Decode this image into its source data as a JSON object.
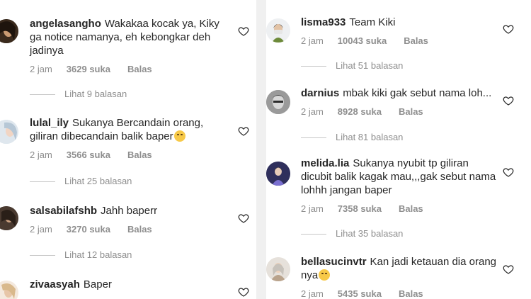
{
  "colors": {
    "text": "#262626",
    "meta": "#8e8e8e",
    "heart_stroke": "#262626",
    "background": "#ffffff"
  },
  "left_column": [
    {
      "username": "angelasangho",
      "text": "Wakakaa kocak ya, Kiky ga notice namanya, eh kebongkar deh jadinya",
      "time": "2 jam",
      "likes": "3629 suka",
      "reply": "Balas",
      "view_replies": "Lihat 9 balasan"
    },
    {
      "username": "lulal_ily",
      "text": "Sukanya Bercandain orang, giliran dibecandain balik baper",
      "emoji": "crying-face-icon",
      "time": "2 jam",
      "likes": "3566 suka",
      "reply": "Balas",
      "view_replies": "Lihat 25 balasan"
    },
    {
      "username": "salsabilafshb",
      "text": "Jahh baperr",
      "time": "2 jam",
      "likes": "3270 suka",
      "reply": "Balas",
      "view_replies": "Lihat 12 balasan"
    },
    {
      "username": "zivaasyah",
      "text": "Baper"
    }
  ],
  "right_column": [
    {
      "username": "lisma933",
      "text": "Team Kiki",
      "time": "2 jam",
      "likes": "10043 suka",
      "reply": "Balas",
      "view_replies": "Lihat 51 balasan"
    },
    {
      "username": "darnius",
      "text": "mbak kiki gak sebut nama loh...",
      "time": "2 jam",
      "likes": "8928 suka",
      "reply": "Balas",
      "view_replies": "Lihat 81 balasan"
    },
    {
      "username": "melida.lia",
      "text": "Sukanya nyubit tp giliran dicubit balik kagak mau,,,gak sebut nama lohhh jangan baper",
      "time": "2 jam",
      "likes": "7358 suka",
      "reply": "Balas",
      "view_replies": "Lihat 35 balasan"
    },
    {
      "username": "bellasucinvtr",
      "text": "Kan jadi ketauan dia orang nya",
      "emoji": "laughing-face-icon",
      "time": "2 jam",
      "likes": "5435 suka",
      "reply": "Balas"
    }
  ]
}
